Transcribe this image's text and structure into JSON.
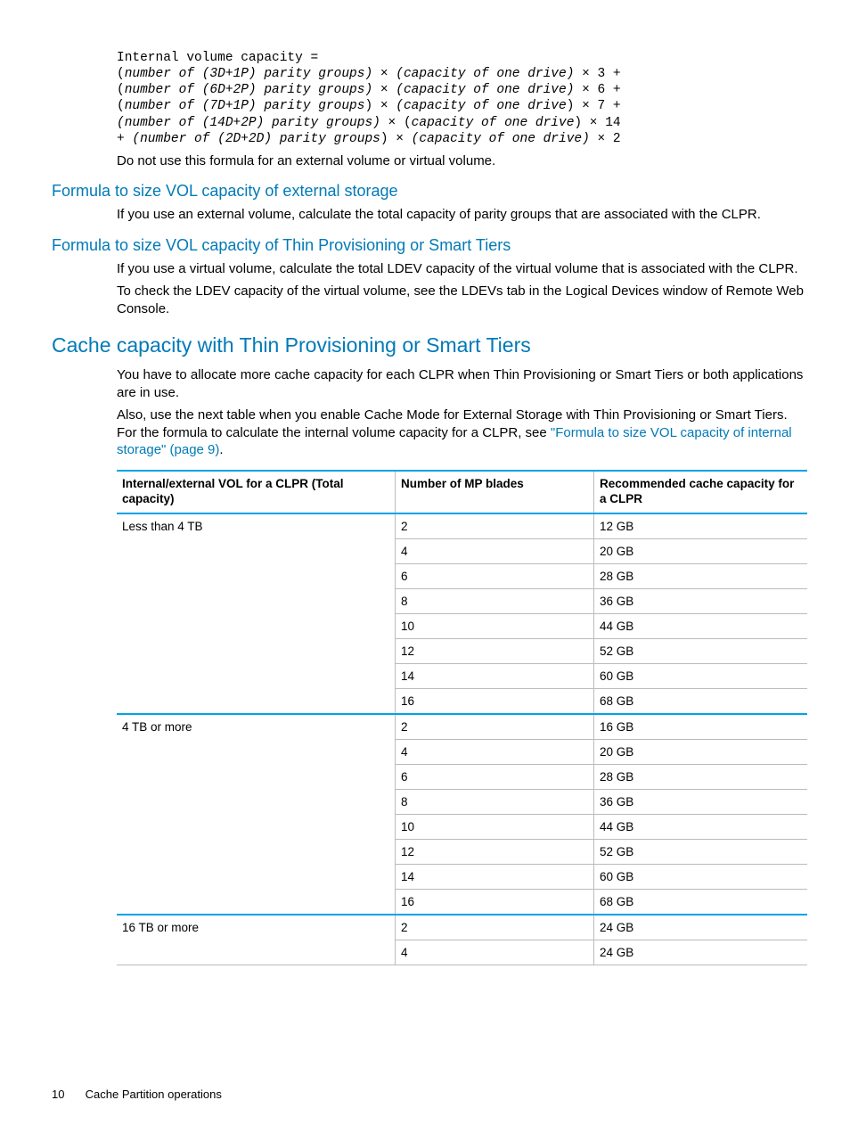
{
  "code": {
    "l1a": "Internal volume capacity =",
    "l2a": "(",
    "l2b": "number of (3D+1P) parity groups)",
    "l2c": " × ",
    "l2d": "(capacity of one drive)",
    "l2e": " × 3 +",
    "l3a": "(",
    "l3b": "number of (6D+2P) parity groups)",
    "l3c": " × ",
    "l3d": "(capacity of one drive)",
    "l3e": " × 6 +",
    "l4a": "(",
    "l4b": "number of (7D+1P) parity groups",
    "l4c": ") × ",
    "l4d": "(capacity of one drive",
    "l4e": ") × 7 +",
    "l5a": "(number of (14D+2P) parity groups)",
    "l5b": " × (",
    "l5c": "capacity of one drive",
    "l5d": ") × 14",
    "l6a": "+ ",
    "l6b": "(number of (2D+2D) parity groups",
    "l6c": ") × ",
    "l6d": "(capacity of one drive)",
    "l6e": " × 2"
  },
  "p_after_code": "Do not use this formula for an external volume or virtual volume.",
  "h3a": "Formula to size VOL capacity of external storage",
  "p_h3a": "If you use an external volume, calculate the total capacity of parity groups that are associated with the CLPR.",
  "h3b": "Formula to size VOL capacity of Thin Provisioning or Smart Tiers",
  "p_h3b_1": "If you use a virtual volume, calculate the total LDEV capacity of the virtual volume that is associated with the CLPR.",
  "p_h3b_2": "To check the LDEV capacity of the virtual volume, see the LDEVs tab in the Logical Devices window of Remote Web Console.",
  "h2": "Cache capacity with Thin Provisioning or Smart Tiers",
  "p_h2_1": "You have to allocate more cache capacity for each CLPR when Thin Provisioning or Smart Tiers or both applications are in use.",
  "p_h2_2a": "Also, use the next table when you enable Cache Mode for External Storage with Thin Provisioning or Smart Tiers. For the formula to calculate the internal volume capacity for a CLPR, see ",
  "p_h2_2link": "\"Formula to size VOL capacity of internal storage\" (page 9)",
  "p_h2_2b": ".",
  "table": {
    "headers": {
      "c1": "Internal/external VOL for a CLPR (Total capacity)",
      "c2": "Number of MP blades",
      "c3": "Recommended cache capacity for a CLPR"
    },
    "groups": [
      {
        "label": "Less than 4 TB",
        "rows": [
          {
            "mp": "2",
            "cc": "12 GB"
          },
          {
            "mp": "4",
            "cc": "20 GB"
          },
          {
            "mp": "6",
            "cc": "28 GB"
          },
          {
            "mp": "8",
            "cc": "36 GB"
          },
          {
            "mp": "10",
            "cc": "44 GB"
          },
          {
            "mp": "12",
            "cc": "52 GB"
          },
          {
            "mp": "14",
            "cc": "60 GB"
          },
          {
            "mp": "16",
            "cc": "68 GB"
          }
        ]
      },
      {
        "label": "4 TB or more",
        "rows": [
          {
            "mp": "2",
            "cc": "16 GB"
          },
          {
            "mp": "4",
            "cc": "20 GB"
          },
          {
            "mp": "6",
            "cc": "28 GB"
          },
          {
            "mp": "8",
            "cc": "36 GB"
          },
          {
            "mp": "10",
            "cc": "44 GB"
          },
          {
            "mp": "12",
            "cc": "52 GB"
          },
          {
            "mp": "14",
            "cc": "60 GB"
          },
          {
            "mp": "16",
            "cc": "68 GB"
          }
        ]
      },
      {
        "label": "16 TB or more",
        "rows": [
          {
            "mp": "2",
            "cc": "24 GB"
          },
          {
            "mp": "4",
            "cc": "24 GB"
          }
        ]
      }
    ]
  },
  "footer": {
    "page": "10",
    "section": "Cache Partition operations"
  }
}
